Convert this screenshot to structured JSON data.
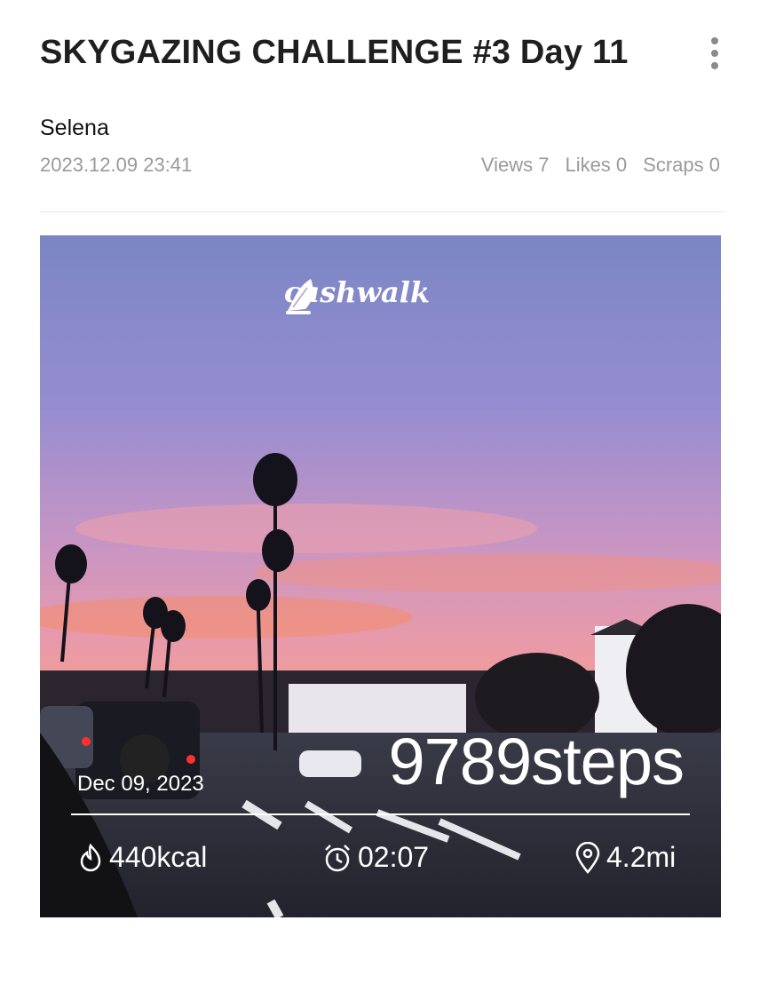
{
  "post": {
    "title": "SKYGAZING CHALLENGE #3 Day 11",
    "author": "Selena",
    "datetime": "2023.12.09 23:41",
    "stats": {
      "views": "Views 7",
      "likes": "Likes 0",
      "scraps": "Scraps 0"
    }
  },
  "photo_overlay": {
    "brand": "cashwalk",
    "steps": "9789steps",
    "date": "Dec 09, 2023",
    "calories": "440kcal",
    "duration": "02:07",
    "distance": "4.2mi"
  },
  "icons": {
    "menu": "more-vertical-icon",
    "calories": "flame-icon",
    "duration": "alarm-clock-icon",
    "distance": "location-pin-icon",
    "brand": "feather-shoe-icon"
  }
}
